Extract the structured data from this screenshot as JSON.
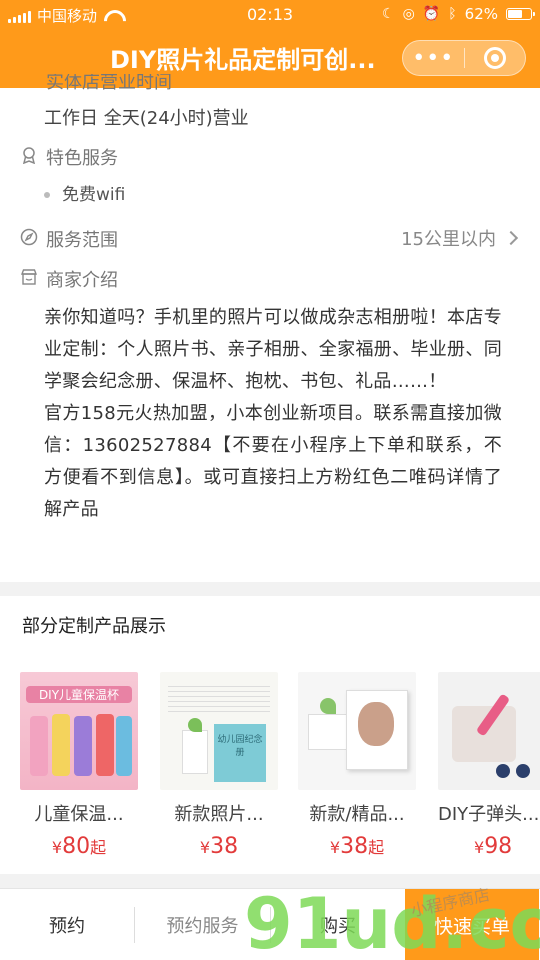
{
  "status_bar": {
    "carrier": "中国移动",
    "time": "02:13",
    "battery": "62%"
  },
  "nav": {
    "title": "DIY照片礼品定制可创...",
    "more_label": "•••"
  },
  "info": {
    "hours_label_partial": "实体店营业时间",
    "hours_value": "工作日  全天(24小时)营业",
    "features_label": "特色服务",
    "features": [
      "免费wifi"
    ],
    "range_label": "服务范围",
    "range_value": "15公里以内",
    "intro_label": "商家介绍",
    "intro_text": "亲你知道吗？手机里的照片可以做成杂志相册啦！本店专业定制：个人照片书、亲子相册、全家福册、毕业册、同学聚会纪念册、保温杯、抱枕、书包、礼品……！\n官方158元火热加盟，小本创业新项目。联系需直接加微信：13602527884【不要在小程序上下单和联系，不方便看不到信息】。或可直接扫上方粉红色二唯码详情了解产品"
  },
  "products": {
    "title": "部分定制产品展示",
    "items": [
      {
        "name": "儿童保温...",
        "price_symbol": "¥",
        "price": "80",
        "suffix": "起",
        "thumb_text": "DIY儿童保温杯"
      },
      {
        "name": "新款照片...",
        "price_symbol": "¥",
        "price": "38",
        "suffix": "",
        "thumb_text": "幼儿园纪念册"
      },
      {
        "name": "新款/精品...",
        "price_symbol": "¥",
        "price": "38",
        "suffix": "起",
        "thumb_text": ""
      },
      {
        "name": "DIY子弹头...",
        "price_symbol": "¥",
        "price": "98",
        "suffix": "",
        "thumb_text": ""
      }
    ]
  },
  "bottom_bar": {
    "reserve": "预约",
    "reserve_service": "预约服务",
    "buy": "购买",
    "quick_buy": "快速买单"
  },
  "watermark": {
    "text": "91ud.com",
    "script": "小程序商店"
  },
  "colors": {
    "brand_orange": "#ff9a1a",
    "price_red": "#e23b3b"
  }
}
